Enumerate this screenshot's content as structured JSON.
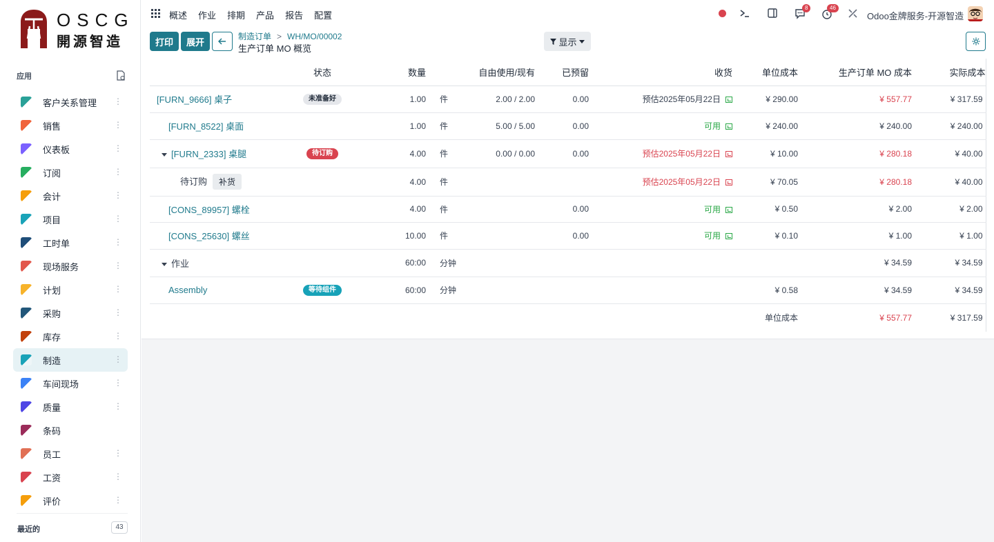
{
  "brand": {
    "logo_latin": "OSCG",
    "logo_cn": "開源智造"
  },
  "sidebar": {
    "title": "应用",
    "items": [
      {
        "label": "客户关系管理",
        "icon": "crm-icon",
        "color": "#2aa198"
      },
      {
        "label": "销售",
        "icon": "sales-icon",
        "color": "#f0643c"
      },
      {
        "label": "仪表板",
        "icon": "dashboard-icon",
        "color": "#7b61ff"
      },
      {
        "label": "订阅",
        "icon": "subscription-icon",
        "color": "#27ae60"
      },
      {
        "label": "会计",
        "icon": "accounting-icon",
        "color": "#f59e0b"
      },
      {
        "label": "项目",
        "icon": "project-icon",
        "color": "#1aa3b8"
      },
      {
        "label": "工时单",
        "icon": "timesheet-icon",
        "color": "#1f4e79"
      },
      {
        "label": "现场服务",
        "icon": "field-service-icon",
        "color": "#e2574c"
      },
      {
        "label": "计划",
        "icon": "planning-icon",
        "color": "#f7b32b"
      },
      {
        "label": "采购",
        "icon": "purchase-icon",
        "color": "#22577a"
      },
      {
        "label": "库存",
        "icon": "inventory-icon",
        "color": "#c2410c"
      },
      {
        "label": "制造",
        "icon": "manufacturing-icon",
        "color": "#1aa3b8"
      },
      {
        "label": "车间现场",
        "icon": "shop-floor-icon",
        "color": "#3b82f6"
      },
      {
        "label": "质量",
        "icon": "quality-icon",
        "color": "#4f46e5"
      },
      {
        "label": "条码",
        "icon": "barcode-icon",
        "color": "#9b2c5a"
      },
      {
        "label": "员工",
        "icon": "employees-icon",
        "color": "#e17055"
      },
      {
        "label": "工资",
        "icon": "payroll-icon",
        "color": "#d9434f"
      },
      {
        "label": "评价",
        "icon": "appraisal-icon",
        "color": "#f59e0b"
      }
    ],
    "recent_label": "最近的",
    "recent_count": "43"
  },
  "topnav": {
    "menu": [
      "概述",
      "作业",
      "排期",
      "产品",
      "报告",
      "配置"
    ],
    "chat_badge": "8",
    "activity_badge": "46",
    "company": "Odoo金牌服务-开源智造"
  },
  "control": {
    "print_label": "打印",
    "expand_label": "展开",
    "breadcrumb": [
      "制造订单",
      "WH/MO/00002"
    ],
    "subtitle": "生产订单 MO 概览",
    "display_label": "显示"
  },
  "table": {
    "headers": [
      "状态",
      "数量",
      "自由使用/现有",
      "已预留",
      "收货",
      "单位成本",
      "生产订单 MO 成本",
      "实际成本"
    ],
    "rows": [
      {
        "name": "[FURN_9666] 桌子",
        "status": "未准备好",
        "qty": "1.00",
        "uom": "件",
        "free": "2.00 / 2.00",
        "reserved": "0.00",
        "receipt": "预估2025年05月22日",
        "unit": "¥ 290.00",
        "mo": "¥ 557.77",
        "real": "¥ 317.59"
      },
      {
        "name": "[FURN_8522] 桌面",
        "status": "",
        "qty": "1.00",
        "uom": "件",
        "free": "5.00 / 5.00",
        "reserved": "0.00",
        "receipt": "可用",
        "unit": "¥ 240.00",
        "mo": "¥ 240.00",
        "real": "¥ 240.00"
      },
      {
        "name": "[FURN_2333] 桌腿",
        "status": "待订购",
        "qty": "4.00",
        "uom": "件",
        "free": "0.00 / 0.00",
        "reserved": "0.00",
        "receipt": "预估2025年05月22日",
        "unit": "¥ 10.00",
        "mo": "¥ 280.18",
        "real": "¥ 40.00"
      },
      {
        "name": "待订购",
        "action": "补货",
        "qty": "4.00",
        "uom": "件",
        "receipt": "预估2025年05月22日",
        "unit": "¥ 70.05",
        "mo": "¥ 280.18",
        "real": "¥ 40.00"
      },
      {
        "name": "[CONS_89957] 螺栓",
        "qty": "4.00",
        "uom": "件",
        "reserved": "0.00",
        "receipt": "可用",
        "unit": "¥ 0.50",
        "mo": "¥ 2.00",
        "real": "¥ 2.00"
      },
      {
        "name": "[CONS_25630] 螺丝",
        "qty": "10.00",
        "uom": "件",
        "reserved": "0.00",
        "receipt": "可用",
        "unit": "¥ 0.10",
        "mo": "¥ 1.00",
        "real": "¥ 1.00"
      },
      {
        "name": "作业",
        "qty": "60:00",
        "uom": "分钟",
        "mo": "¥ 34.59",
        "real": "¥ 34.59"
      },
      {
        "name": "Assembly",
        "status": "等待组件",
        "qty": "60:00",
        "uom": "分钟",
        "unit": "¥ 0.58",
        "mo": "¥ 34.59",
        "real": "¥ 34.59"
      }
    ],
    "total": {
      "label": "单位成本",
      "mo": "¥ 557.77",
      "real": "¥ 317.59"
    }
  }
}
